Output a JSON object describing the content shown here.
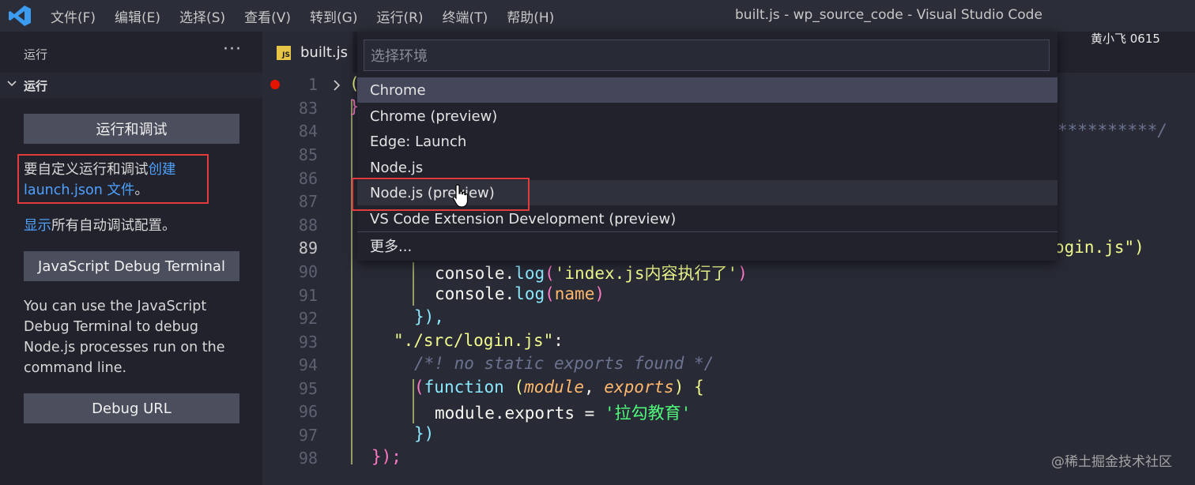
{
  "app": {
    "window_title": "built.js - wp_source_code - Visual Studio Code",
    "menu": [
      "文件(F)",
      "编辑(E)",
      "选择(S)",
      "查看(V)",
      "转到(G)",
      "运行(R)",
      "终端(T)",
      "帮助(H)"
    ]
  },
  "sidebar": {
    "header": "运行",
    "more": "···",
    "section_title": "运行",
    "run_debug_button": "运行和调试",
    "customize_text": "要自定义运行和调试",
    "create_link": "创建",
    "launch_link": "launch.json 文件",
    "period": "。",
    "show_link": "显示",
    "show_text": "所有自动调试配置。",
    "js_debug_button": "JavaScript Debug Terminal",
    "js_debug_desc": "You can use the JavaScript Debug Terminal to debug Node.js processes run on the command line.",
    "debug_url_button": "Debug URL"
  },
  "editor": {
    "tab_label": "built.js",
    "tab_badge": "JS",
    "line_numbers": [
      "1",
      "83",
      "84",
      "85",
      "86",
      "87",
      "88",
      "89",
      "90",
      "91",
      "92",
      "93",
      "94",
      "95",
      "96",
      "97",
      "98"
    ],
    "visible_fragments": {
      "line1_open": "(",
      "line83_close": "}",
      "comment_tail": "**********/",
      "login_tail": "ogin.js\")",
      "l90": {
        "obj": "console",
        "dot": ".",
        "fn": "log",
        "open": "(",
        "str": "'index.js内容执行了'",
        "close": ")"
      },
      "l91": {
        "obj": "console",
        "dot": ".",
        "fn": "log",
        "open": "(",
        "arg": "name",
        "close": ")"
      },
      "l92": "}),",
      "l93": {
        "str": "\"./src/login.js\"",
        "colon": ":"
      },
      "l94": "/*! no static exports found */",
      "l95": {
        "open": "(",
        "kw": "function",
        "sp": " ",
        "po": "(",
        "p1": "module",
        "comma": ", ",
        "p2": "exports",
        "pc": ")",
        "brace": " {"
      },
      "l96": {
        "lhs": "module.exports",
        "eq": " = ",
        "str": "'拉勾教育'"
      },
      "l97": "})",
      "l98": "});"
    }
  },
  "quick_pick": {
    "placeholder": "选择环境",
    "items": [
      "Chrome",
      "Chrome (preview)",
      "Edge: Launch",
      "Node.js",
      "Node.js (preview)",
      "VS Code Extension Development (preview)",
      "更多..."
    ]
  },
  "overlay": {
    "user_tag": "黄小飞 0615",
    "watermark": "@稀土掘金技术社区"
  },
  "colors": {
    "accent_link": "#4ea1ff",
    "highlight_box": "#e23b3b",
    "breakpoint": "#e51400"
  }
}
